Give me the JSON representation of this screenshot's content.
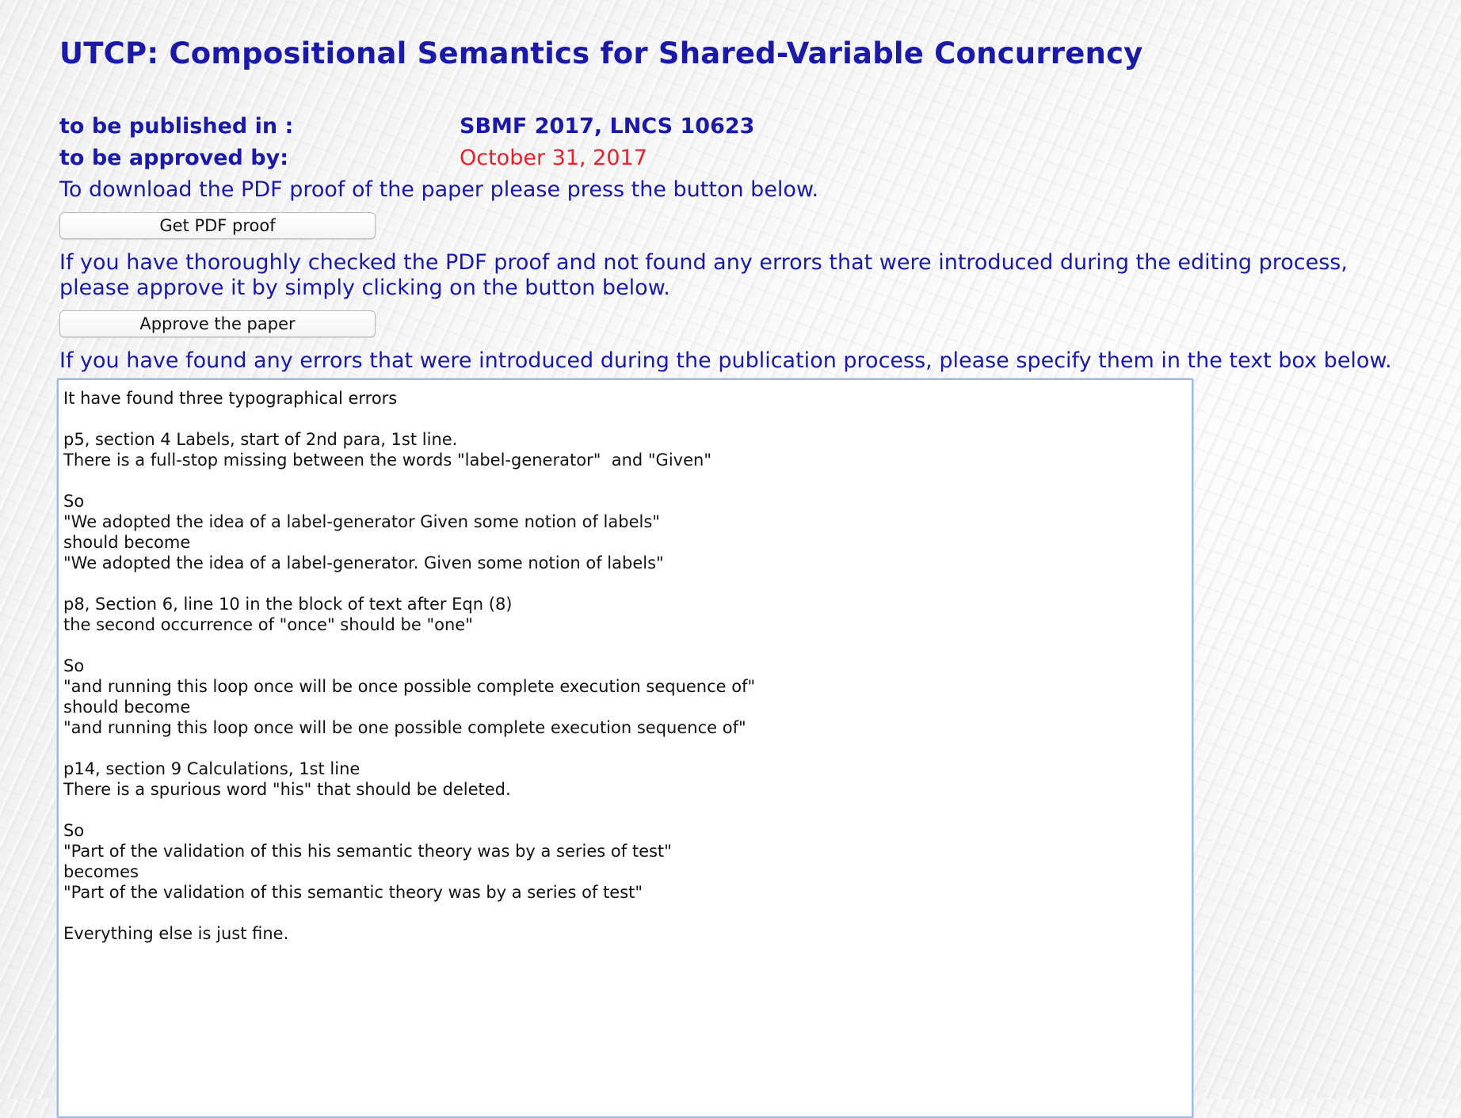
{
  "page": {
    "title": "UTCP: Compositional Semantics for Shared-Variable Concurrency"
  },
  "meta": {
    "published_label": "to be published in :",
    "published_value": "SBMF 2017, LNCS 10623",
    "approved_label": "to be approved by:",
    "approved_value": "October 31, 2017"
  },
  "instructions": {
    "download": "To download the PDF proof of the paper please press the button below.",
    "approve": "If you have thoroughly checked the PDF proof and not found any errors that were introduced during the editing process, please approve it by simply clicking on the button below.",
    "errors": "If you have found any errors that were introduced during the publication process, please specify them in the text box below."
  },
  "buttons": {
    "get_pdf": "Get PDF proof",
    "approve": "Approve the paper"
  },
  "error_box": {
    "value": "It have found three typographical errors\n\np5, section 4 Labels, start of 2nd para, 1st line.\nThere is a full-stop missing between the words \"label-generator\"  and \"Given\"\n\nSo\n\"We adopted the idea of a label-generator Given some notion of labels\"\nshould become\n\"We adopted the idea of a label-generator. Given some notion of labels\"\n\np8, Section 6, line 10 in the block of text after Eqn (8)\nthe second occurrence of \"once\" should be \"one\"\n\nSo\n\"and running this loop once will be once possible complete execution sequence of\"\nshould become\n\"and running this loop once will be one possible complete execution sequence of\"\n\np14, section 9 Calculations, 1st line\nThere is a spurious word \"his\" that should be deleted.\n\nSo\n\"Part of the validation of this his semantic theory was by a series of test\"\nbecomes\n\"Part of the validation of this semantic theory was by a series of test\"\n\nEverything else is just fine."
  },
  "colors": {
    "heading_blue": "#1a1aa6",
    "deadline_red": "#e8202a"
  }
}
